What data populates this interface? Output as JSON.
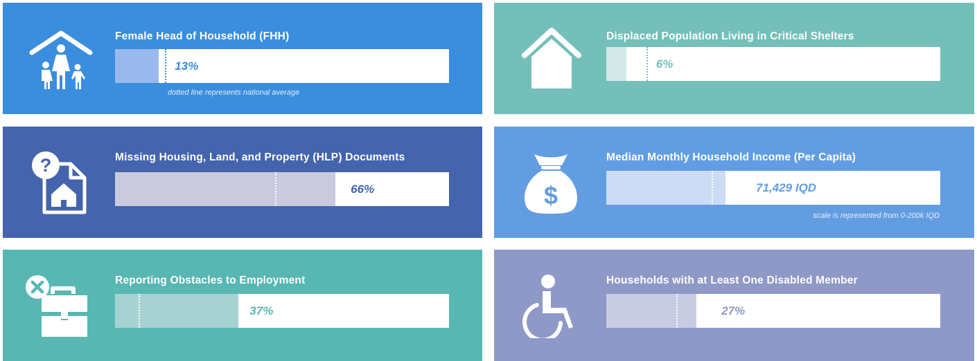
{
  "colors": {
    "fhh_card": "#3b8ddd",
    "shelters_card": "#74bfba",
    "hlp_card": "#4464ae",
    "income_card": "#629de2",
    "employment_card": "#58b7b2",
    "disabled_card": "#8e99c7"
  },
  "cards": {
    "fhh": {
      "title": "Female Head of Household (FHH)",
      "value_label": "13%",
      "note": "dotted line represents national average",
      "icon": "family-house-icon"
    },
    "shelters": {
      "title": "Displaced Population Living in Critical Shelters",
      "value_label": "6%",
      "icon": "house-icon"
    },
    "hlp": {
      "title": "Missing Housing, Land, and Property (HLP) Documents",
      "value_label": "66%",
      "icon": "missing-document-icon"
    },
    "income": {
      "title": "Median Monthly Household Income (Per Capita)",
      "value_label": "71,429 IQD",
      "note": "scale is represented from 0-200k IQD",
      "icon": "money-bag-icon"
    },
    "employment": {
      "title": "Reporting Obstacles to Employment",
      "value_label": "37%",
      "icon": "briefcase-blocked-icon"
    },
    "disabled": {
      "title": "Households with at Least One Disabled Member",
      "value_label": "27%",
      "icon": "wheelchair-icon"
    }
  },
  "chart_data": [
    {
      "type": "bar",
      "title": "Female Head of Household (FHH)",
      "value": 13,
      "national_average": 15,
      "unit": "%",
      "xlim": [
        0,
        100
      ]
    },
    {
      "type": "bar",
      "title": "Displaced Population Living in Critical Shelters",
      "value": 6,
      "national_average": 12,
      "unit": "%",
      "xlim": [
        0,
        100
      ]
    },
    {
      "type": "bar",
      "title": "Missing Housing, Land, and Property (HLP) Documents",
      "value": 66,
      "national_average": 48,
      "unit": "%",
      "xlim": [
        0,
        100
      ]
    },
    {
      "type": "bar",
      "title": "Median Monthly Household Income (Per Capita)",
      "value": 71429,
      "national_average": 63000,
      "unit": "IQD",
      "xlim": [
        0,
        200000
      ]
    },
    {
      "type": "bar",
      "title": "Reporting Obstacles to Employment",
      "value": 37,
      "national_average": 7,
      "unit": "%",
      "xlim": [
        0,
        100
      ]
    },
    {
      "type": "bar",
      "title": "Households with at Least One Disabled Member",
      "value": 27,
      "national_average": 21,
      "unit": "%",
      "xlim": [
        0,
        100
      ]
    }
  ]
}
